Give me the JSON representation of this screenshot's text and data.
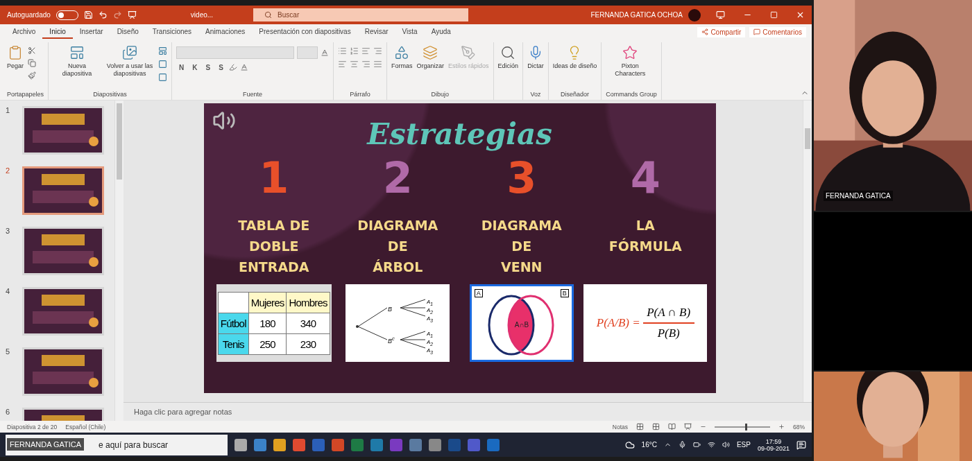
{
  "window": {
    "autosave_label": "Autoguardado",
    "autosave_on": false,
    "file_name": "video...",
    "search_placeholder": "Buscar",
    "user_name": "FERNANDA GATICA OCHOA"
  },
  "menu_tabs": [
    {
      "label": "Archivo",
      "selected": false
    },
    {
      "label": "Inicio",
      "selected": true
    },
    {
      "label": "Insertar",
      "selected": false
    },
    {
      "label": "Diseño",
      "selected": false
    },
    {
      "label": "Transiciones",
      "selected": false
    },
    {
      "label": "Animaciones",
      "selected": false
    },
    {
      "label": "Presentación con diapositivas",
      "selected": false
    },
    {
      "label": "Revisar",
      "selected": false
    },
    {
      "label": "Vista",
      "selected": false
    },
    {
      "label": "Ayuda",
      "selected": false
    }
  ],
  "share_label": "Compartir",
  "comments_label": "Comentarios",
  "ribbon_groups": [
    {
      "label": "Portapapeles",
      "kind": "clipboard",
      "buttons": [
        "Pegar"
      ]
    },
    {
      "label": "Diapositivas",
      "kind": "slides",
      "buttons": [
        "Nueva diapositiva",
        "Volver a usar las diapositivas"
      ]
    },
    {
      "label": "Fuente",
      "kind": "font",
      "buttons": [
        "N",
        "K",
        "S",
        "S"
      ]
    },
    {
      "label": "Párrafo",
      "kind": "paragraph"
    },
    {
      "label": "Dibujo",
      "kind": "drawing",
      "buttons": [
        "Formas",
        "Organizar",
        "Estilos rápidos"
      ]
    },
    {
      "kind": "editing",
      "buttons": [
        "Edición"
      ]
    },
    {
      "label": "Voz",
      "kind": "voice",
      "buttons": [
        "Dictar"
      ]
    },
    {
      "label": "Diseñador",
      "kind": "designer",
      "buttons": [
        "Ideas de diseño"
      ]
    },
    {
      "label": "Commands Group",
      "kind": "pixton",
      "buttons": [
        "Pixton Characters"
      ]
    }
  ],
  "thumbnails": [
    {
      "number": "1",
      "selected": false
    },
    {
      "number": "2",
      "selected": true
    },
    {
      "number": "3",
      "selected": false
    },
    {
      "number": "4",
      "selected": false
    },
    {
      "number": "5",
      "selected": false
    },
    {
      "number": "6",
      "selected": false
    }
  ],
  "slide": {
    "title": "Estrategias",
    "strategies": [
      {
        "number": "1",
        "color": "#e8502a",
        "lines": [
          "TABLA DE",
          "DOBLE",
          "ENTRADA"
        ],
        "kind": "table"
      },
      {
        "number": "2",
        "color": "#b06aa8",
        "lines": [
          "DIAGRAMA",
          "DE",
          "ÁRBOL"
        ],
        "kind": "tree"
      },
      {
        "number": "3",
        "color": "#e8502a",
        "lines": [
          "DIAGRAMA",
          "DE",
          "VENN"
        ],
        "kind": "venn"
      },
      {
        "number": "4",
        "color": "#b06aa8",
        "lines": [
          "LA",
          "FÓRMULA"
        ],
        "kind": "formula"
      }
    ],
    "table": {
      "columns": [
        "Mujeres",
        "Hombres"
      ],
      "rows": [
        {
          "label": "Fútbol",
          "values": [
            "180",
            "340"
          ]
        },
        {
          "label": "Tenis",
          "values": [
            "250",
            "230"
          ]
        }
      ]
    },
    "tree": {
      "branches": [
        {
          "label": "B",
          "leaves": [
            "A$_{1}$",
            "A$_{2}$",
            "A$_{3}$"
          ]
        },
        {
          "label": "B$^{c}$",
          "leaves": [
            "A$_{1}$",
            "A$_{2}$",
            "A$_{3}$"
          ]
        }
      ]
    },
    "venn": {
      "label_a": "A",
      "label_b": "B",
      "intersection": "A∩B"
    },
    "formula": {
      "left": "P(A/B) =",
      "numerator": "P(A ∩ B)",
      "denominator": "P(B)"
    }
  },
  "notes_placeholder": "Haga clic para agregar notas",
  "status_bar": {
    "slide_count": "Diapositiva 2 de 20",
    "language": "Español (Chile)",
    "notes_label": "Notas",
    "zoom": "68%",
    "zoom_level": {
      "level": 0.55
    }
  },
  "taskbar": {
    "search_placeholder": "e aquí para buscar",
    "weather": "16°C",
    "language": "ESP",
    "time": "17:59",
    "date": "09-09-2021"
  },
  "presenter_label": "FERNANDA GATICA",
  "participants": [
    {
      "name": "FERNANDA GATICA",
      "kind": "camera"
    },
    {
      "kind": "blank"
    },
    {
      "kind": "camera"
    }
  ]
}
